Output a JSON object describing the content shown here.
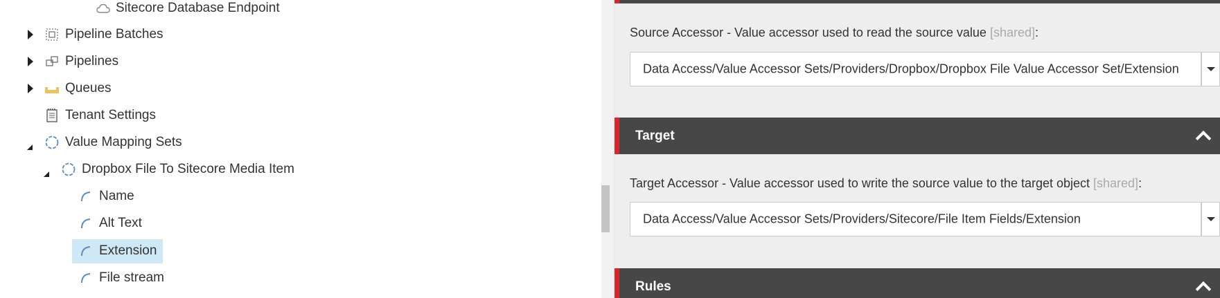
{
  "tree": {
    "items": [
      {
        "label": "Sitecore Database Endpoint",
        "icon": "cloud-icon",
        "expander": "none"
      },
      {
        "label": "Pipeline Batches",
        "icon": "pipeline-batch-icon",
        "expander": "collapsed"
      },
      {
        "label": "Pipelines",
        "icon": "pipelines-icon",
        "expander": "collapsed"
      },
      {
        "label": "Queues",
        "icon": "queue-tray-icon",
        "expander": "collapsed"
      },
      {
        "label": "Tenant Settings",
        "icon": "notepad-icon",
        "expander": "none"
      },
      {
        "label": "Value Mapping Sets",
        "icon": "dashed-circle-icon",
        "expander": "expanded"
      },
      {
        "label": "Dropbox File To Sitecore Media Item",
        "icon": "dashed-circle-icon",
        "expander": "expanded"
      },
      {
        "label": "Name",
        "icon": "arc-icon",
        "expander": "none"
      },
      {
        "label": "Alt Text",
        "icon": "arc-icon",
        "expander": "none"
      },
      {
        "label": "Extension",
        "icon": "arc-icon",
        "expander": "none",
        "selected": true
      },
      {
        "label": "File stream",
        "icon": "arc-icon",
        "expander": "none"
      }
    ]
  },
  "editor": {
    "source_field": {
      "label": "Source Accessor - Value accessor used to read the source value ",
      "shared": "[shared]",
      "suffix": ":",
      "value": "Data Access/Value Accessor Sets/Providers/Dropbox/Dropbox File Value Accessor Set/Extension"
    },
    "target_section": {
      "title": "Target"
    },
    "target_field": {
      "label": "Target Accessor - Value accessor used to write the source value to the target object ",
      "shared": "[shared]",
      "suffix": ":",
      "value": "Data Access/Value Accessor Sets/Providers/Sitecore/File Item Fields/Extension"
    },
    "rules_section": {
      "title": "Rules"
    }
  },
  "colors": {
    "section_header_bg": "#474747",
    "section_accent": "#d9262b",
    "selected_row_bg": "#cfe8f5",
    "editor_bg": "#eeeeee",
    "icon_blue": "#5b8dc0",
    "queue_yellow": "#f0c060"
  }
}
